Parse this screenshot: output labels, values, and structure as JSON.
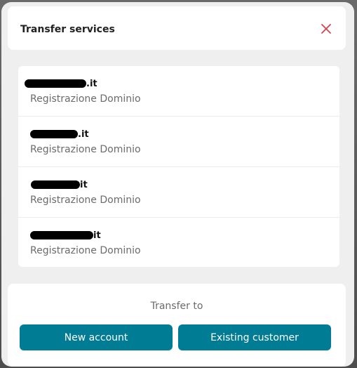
{
  "dialog": {
    "title": "Transfer services",
    "close_icon": "close-icon",
    "accent_color": "#d9434f"
  },
  "services": [
    {
      "domain_tld": ".it",
      "service": "Registrazione Dominio"
    },
    {
      "domain_tld": ".it",
      "service": "Registrazione Dominio"
    },
    {
      "domain_tld": "it",
      "service": "Registrazione Dominio"
    },
    {
      "domain_tld": "it",
      "service": "Registrazione Dominio"
    }
  ],
  "footer": {
    "transfer_label": "Transfer to",
    "new_account_label": "New account",
    "existing_customer_label": "Existing customer",
    "button_color": "#007c94"
  }
}
